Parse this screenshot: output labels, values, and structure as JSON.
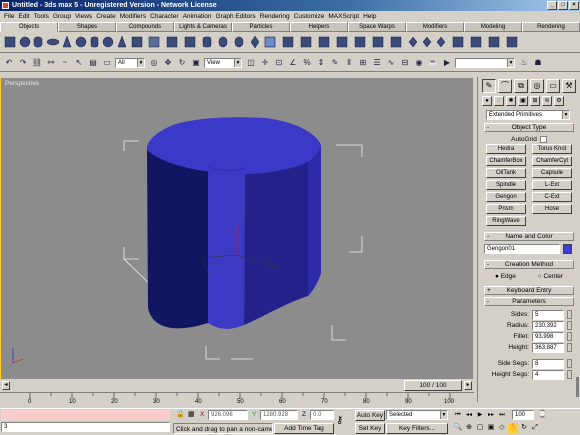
{
  "window": {
    "title": "Untitled - 3ds max 5 - Unregistered Version - Network License"
  },
  "menu": [
    "File",
    "Edit",
    "Tools",
    "Group",
    "Views",
    "Create",
    "Modifiers",
    "Character",
    "Animation",
    "Graph Editors",
    "Rendering",
    "Customize",
    "MAXScript",
    "Help"
  ],
  "tabs": [
    "Objects",
    "Shapes",
    "Compounds",
    "Lights & Cameras",
    "Particles",
    "Helpers",
    "Space Warps",
    "Modifiers",
    "Modeling",
    "Rendering"
  ],
  "toolbar": {
    "selection_filter": "All",
    "ref_coord": "View"
  },
  "viewport": {
    "label": "Perspective"
  },
  "command_panel": {
    "category": "Extended Primitives",
    "object_type_title": "Object Type",
    "autogrid": "AutoGrid",
    "buttons": [
      "Hedra",
      "Torus Knot",
      "ChamferBox",
      "ChamferCyl",
      "OilTank",
      "Capsule",
      "Spindle",
      "L-Ext",
      "Gengon",
      "C-Ext",
      "Prism",
      "Hose",
      "RingWave"
    ],
    "name_color_title": "Name and Color",
    "object_name": "Gengon01",
    "object_color": "#3c3cd2",
    "creation_method_title": "Creation Method",
    "creation_options": [
      "Edge",
      "Center"
    ],
    "keyboard_entry_title": "Keyboard Entry",
    "parameters_title": "Parameters",
    "params": [
      {
        "label": "Sides:",
        "value": "5"
      },
      {
        "label": "Radius:",
        "value": "230.392"
      },
      {
        "label": "Fillet:",
        "value": "93.998"
      },
      {
        "label": "Height:",
        "value": "363.887"
      }
    ],
    "segs": [
      {
        "label": "Side Segs:",
        "value": "8"
      },
      {
        "label": "Height Segs:",
        "value": "4"
      }
    ]
  },
  "timeslider": {
    "frame_label": "100 / 100"
  },
  "ruler_ticks": [
    "0",
    "10",
    "20",
    "30",
    "40",
    "50",
    "60",
    "70",
    "80",
    "90",
    "100"
  ],
  "status": {
    "listener_text": "3",
    "prompt": "Click and drag to pan a non-camer",
    "add_time_tag": "Add Time Tag",
    "x_label": "X",
    "x_value": "926.096",
    "y_label": "Y",
    "y_value": "1280.928",
    "z_label": "Z",
    "z_value": "0.0",
    "auto_key": "Auto Key",
    "set_key": "Set Key",
    "key_mode": "Selected",
    "key_filters": "Key Filters...",
    "frame_field": "100"
  },
  "accent": "#ffcc33"
}
